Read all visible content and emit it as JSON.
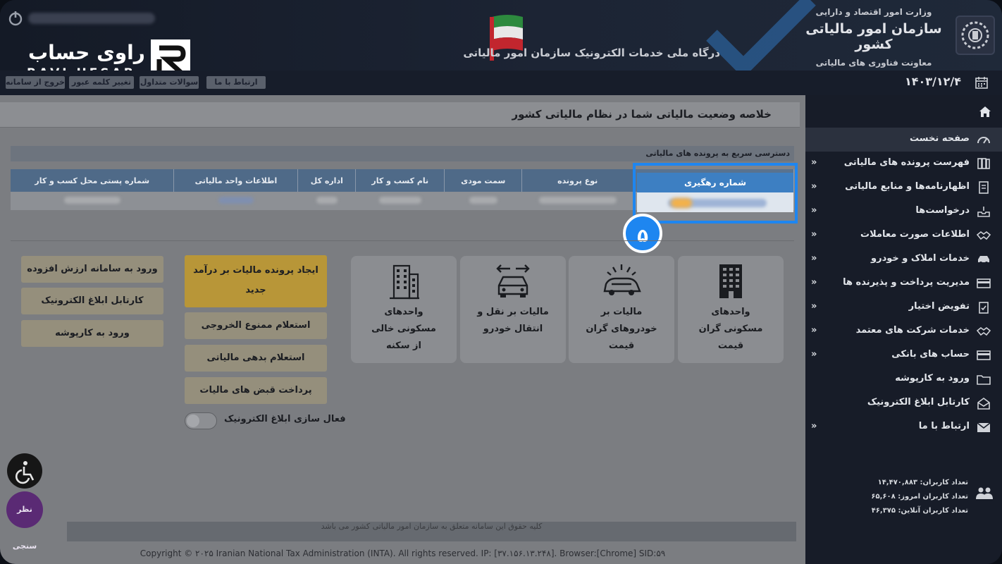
{
  "header": {
    "portal_title": "درگاه ملی خدمات الکترونیک سازمان امور مالیاتی",
    "ministry": "وزارت امور اقتصاد و دارایی",
    "org_name": "سازمان امور مالیاتی کشور",
    "deputy": "معاونت فناوری های مالیاتی"
  },
  "logo": {
    "fa": "راوی حساب",
    "en": "RAVI HESAB"
  },
  "toolbar": {
    "contact": "ارتباط با ما",
    "faq": "سوالات متداول",
    "change_password": "تغییر کلمه عبور",
    "logout": "خروج از سامانه",
    "date": "۱۴۰۳/۱۲/۴"
  },
  "main": {
    "summary_title": "خلاصه وضعیت مالیاتی شما در نظام مالیاتی کشور",
    "quick_access_title": "دسترسی سریع به پرونده های مالیاتی",
    "table_headers": [
      "شماره رهگیری",
      "نوع پرونده",
      "سمت مودی",
      "نام کسب و کار",
      "اداره کل",
      "اطلاعات واحد مالیاتی",
      "شماره پستی محل کسب و کار"
    ],
    "step_badge": "۵",
    "tiles": [
      {
        "label": "واحدهای مسکونی گران قیمت",
        "icon": "building-icon"
      },
      {
        "label": "مالیات بر خودروهای گران قیمت",
        "icon": "car-alert-icon"
      },
      {
        "label": "مالیات بر نقل و انتقال خودرو",
        "icon": "car-transfer-icon"
      },
      {
        "label": "واحدهای مسکونی خالی از سکنه",
        "icon": "apartment-icon"
      }
    ],
    "actions": {
      "create_file": "ایجاد پرونده مالیات بر درآمد جدید",
      "exit_ban": "استعلام ممنوع الخروجی",
      "tax_debt": "استعلام بدهی مالیاتی",
      "pay_bills": "پرداخت قبض های مالیات"
    },
    "side_actions": {
      "vat": "ورود به سامانه ارزش افزوده",
      "e_notice": "کارتابل ابلاغ الکترونیک",
      "karposhe": "ورود به کارپوشه"
    },
    "toggle_label": "فعال سازی ابلاغ الکترونیک",
    "footer_notice": "کلیه حقوق این سامانه متعلق به سازمان امور مالیاتی کشور می باشد",
    "copyright": "Copyright © ۲۰۲۵ Iranian National Tax Administration (INTA). All rights reserved. IP: [۳۷.۱۵۶.۱۳.۲۴۸]. Browser:[Chrome] SID:۵۹",
    "survey": "نظر سنجی"
  },
  "sidebar": {
    "items": [
      {
        "label": "صفحه نخست",
        "icon": "dashboard-icon",
        "chevron": false,
        "active": true
      },
      {
        "label": "فهرست پرونده های مالیاتی",
        "icon": "files-icon",
        "chevron": true
      },
      {
        "label": "اظهارنامه‌ها و منابع مالیاتی",
        "icon": "document-icon",
        "chevron": true
      },
      {
        "label": "درخواست‌ها",
        "icon": "inbox-icon",
        "chevron": true
      },
      {
        "label": "اطلاعات صورت معاملات",
        "icon": "handshake-icon",
        "chevron": true
      },
      {
        "label": "خدمات املاک و خودرو",
        "icon": "car-icon",
        "chevron": true
      },
      {
        "label": "مدیریت پرداخت و پذیرنده ها",
        "icon": "card-icon",
        "chevron": true
      },
      {
        "label": "تفویض اختیار",
        "icon": "clipboard-check-icon",
        "chevron": true
      },
      {
        "label": "خدمات شرکت های معتمد",
        "icon": "handshake-icon",
        "chevron": true
      },
      {
        "label": "حساب های بانکی",
        "icon": "bank-card-icon",
        "chevron": true
      },
      {
        "label": "ورود به کارپوشه",
        "icon": "folder-icon",
        "chevron": false
      },
      {
        "label": "کارتابل ابلاغ الکترونیک",
        "icon": "mail-open-icon",
        "chevron": false
      },
      {
        "label": "ارتباط با ما",
        "icon": "envelope-icon",
        "chevron": true
      }
    ],
    "stats": {
      "total_users": "تعداد کاربران: ۱۴,۴۷۰,۸۸۳",
      "today_users": "تعداد کاربران امروز: ۶۵,۶۰۸",
      "online_users": "تعداد کاربران آنلاین: ۴۶,۳۷۵"
    }
  }
}
